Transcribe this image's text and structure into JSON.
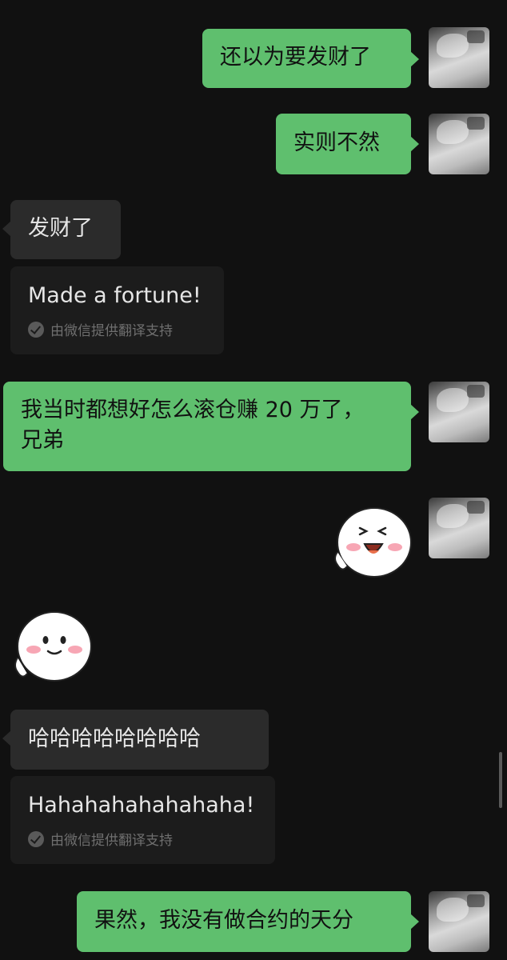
{
  "colors": {
    "background": "#111111",
    "outgoing_bubble": "#5fbf6e",
    "incoming_bubble": "#2b2b2b",
    "translation_box": "#1c1c1c"
  },
  "messages": {
    "m1": {
      "text": "还以为要发财了"
    },
    "m2": {
      "text": "实则不然"
    },
    "m3": {
      "text": "发财了",
      "translation": "Made a fortune!",
      "credit": "由微信提供翻译支持"
    },
    "m4": {
      "line1": "我当时都想好怎么滚仓赚 20 万了，",
      "line2": "兄弟"
    },
    "m5": {
      "sticker": "laughing-face-waving-sticker"
    },
    "m6": {
      "sticker": "smiling-face-waving-sticker"
    },
    "m7": {
      "text": "哈哈哈哈哈哈哈哈",
      "translation": "Hahahahahahahaha!",
      "credit": "由微信提供翻译支持"
    },
    "m8": {
      "text": "果然，我没有做合约的天分"
    }
  }
}
